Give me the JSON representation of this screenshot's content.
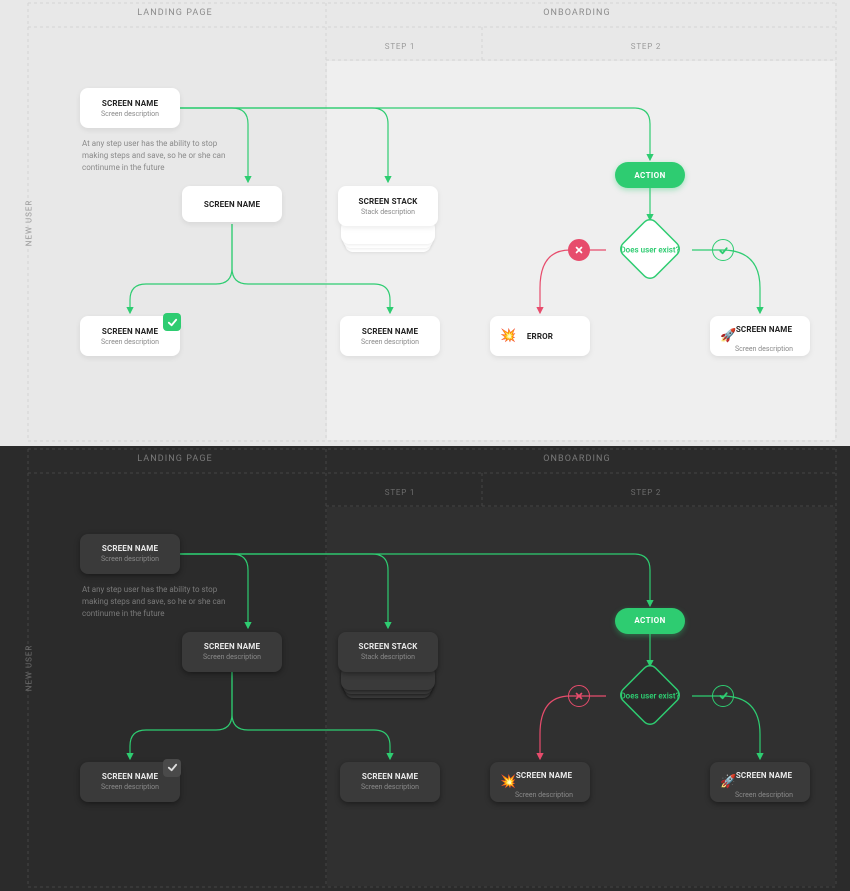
{
  "colors": {
    "accent": "#2ecc71",
    "error": "#e74c6c",
    "light_bg": "#e8e8e8",
    "dark_bg": "#2b2b2b",
    "light_card": "#ffffff",
    "dark_card": "#3a3a3a"
  },
  "columns": {
    "landing_page": "LANDING PAGE",
    "onboarding": "ONBOARDING",
    "step1": "STEP 1",
    "step2": "STEP 2"
  },
  "row": {
    "new_user": "NEW USER"
  },
  "note": "At any step user has the ability to stop making steps and save, so he or she can continume in the future",
  "nodes": {
    "screen_start": {
      "title": "SCREEN NAME",
      "desc": "Screen description"
    },
    "screen_mid": {
      "title": "SCREEN NAME"
    },
    "stack": {
      "title": "SCREEN STACK",
      "desc": "Stack description"
    },
    "screen_bl": {
      "title": "SCREEN NAME",
      "desc": "Screen description"
    },
    "screen_bc": {
      "title": "SCREEN NAME",
      "desc": "Screen description"
    },
    "action": {
      "label": "ACTION"
    },
    "decision": {
      "label": "Does user exist?"
    },
    "decision_no": {
      "emoji": "💥",
      "title": "ERROR"
    },
    "decision_no_dark": {
      "emoji": "💥",
      "title": "SCREEN NAME",
      "desc": "Screen description"
    },
    "decision_yes": {
      "emoji": "🚀",
      "title": "SCREEN NAME",
      "desc": "Screen description"
    }
  }
}
